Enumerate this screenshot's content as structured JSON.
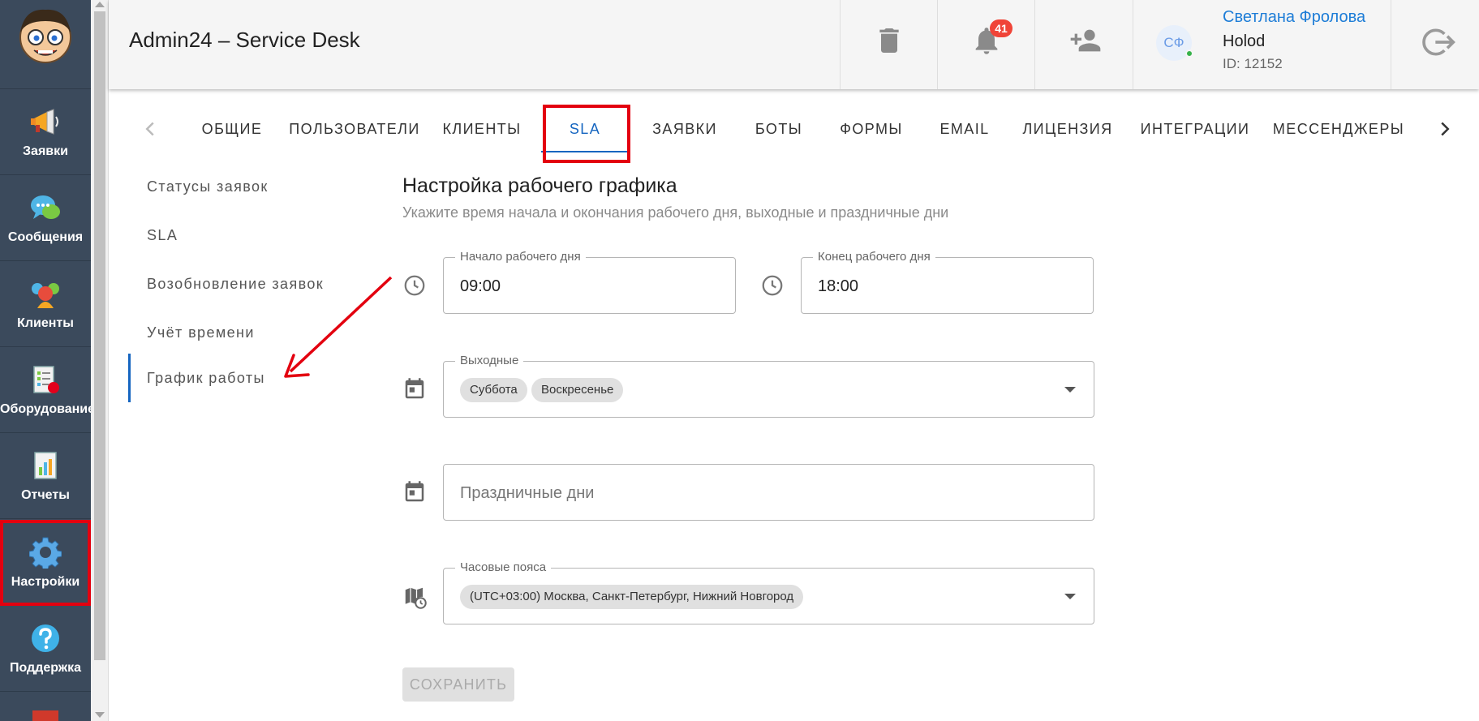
{
  "header": {
    "app_title": "Admin24 – Service Desk",
    "notifications_count": "41",
    "user": {
      "initials": "СФ",
      "name": "Светлана Фролова",
      "company": "Holod",
      "id_text": "ID: 12152"
    }
  },
  "leftnav": {
    "items": [
      {
        "label": "Заявки",
        "icon": "megaphone-icon"
      },
      {
        "label": "Сообщения",
        "icon": "chat-bubbles-icon"
      },
      {
        "label": "Клиенты",
        "icon": "users-icon"
      },
      {
        "label": "Оборудование",
        "icon": "equipment-list-icon"
      },
      {
        "label": "Отчеты",
        "icon": "report-chart-icon"
      },
      {
        "label": "Настройки",
        "icon": "gear-icon"
      },
      {
        "label": "Поддержка",
        "icon": "help-icon"
      }
    ]
  },
  "tabs": {
    "items": [
      "Общие",
      "Пользователи",
      "Клиенты",
      "SLA",
      "Заявки",
      "Боты",
      "Формы",
      "Email",
      "Лицензия",
      "Интеграции",
      "Мессенджеры"
    ],
    "active": "SLA"
  },
  "subnav": {
    "items": [
      "Статусы заявок",
      "SLA",
      "Возобновление заявок",
      "Учёт времени",
      "График работы"
    ],
    "active": "График работы"
  },
  "form": {
    "title": "Настройка рабочего графика",
    "subtitle": "Укажите время начала и окончания рабочего дня, выходные и праздничные дни",
    "start": {
      "label": "Начало рабочего дня",
      "value": "09:00"
    },
    "end": {
      "label": "Конец рабочего дня",
      "value": "18:00"
    },
    "weekends": {
      "label": "Выходные",
      "chips": [
        "Суббота",
        "Воскресенье"
      ]
    },
    "holidays": {
      "placeholder": "Праздничные дни"
    },
    "timezone": {
      "label": "Часовые пояса",
      "chip": "(UTC+03:00) Москва, Санкт-Петербург, Нижний Новгород"
    },
    "save_label": "Сохранить"
  },
  "colors": {
    "nav_bg": "#3b4a5c",
    "accent": "#1565c0",
    "highlight": "#e3000f",
    "badge": "#f04438",
    "link": "#1e7dd7"
  }
}
